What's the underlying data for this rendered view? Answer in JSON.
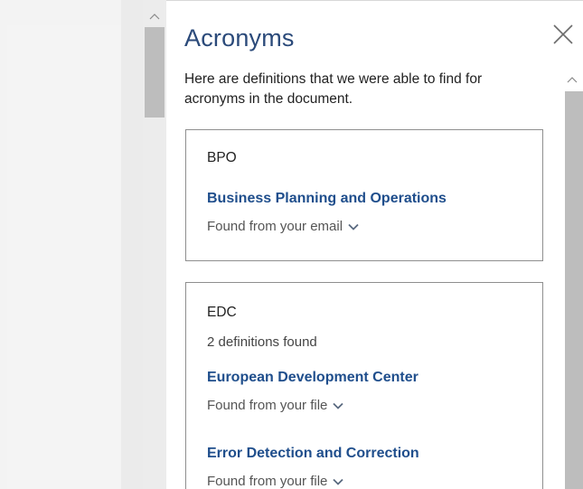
{
  "doc": {
    "scroll_up_glyph": "^"
  },
  "pane": {
    "title": "Acronyms",
    "description": "Here are definitions that we were able to find for acronyms in the document.",
    "scroll_up_glyph": "^"
  },
  "cards": [
    {
      "acronym": "BPO",
      "definitions": [
        {
          "term": "Business Planning and Operations",
          "source": "Found from your email"
        }
      ]
    },
    {
      "acronym": "EDC",
      "count_text": "2 definitions found",
      "definitions": [
        {
          "term": "European Development Center",
          "source": "Found from your file"
        },
        {
          "term": "Error Detection and Correction",
          "source": "Found from your file"
        }
      ]
    }
  ],
  "colors": {
    "title": "#2b4a7a",
    "link": "#1f4e8c",
    "border": "#8f8f8f"
  },
  "icons": {
    "close": "close-icon",
    "expand": "chevron-down-icon"
  }
}
